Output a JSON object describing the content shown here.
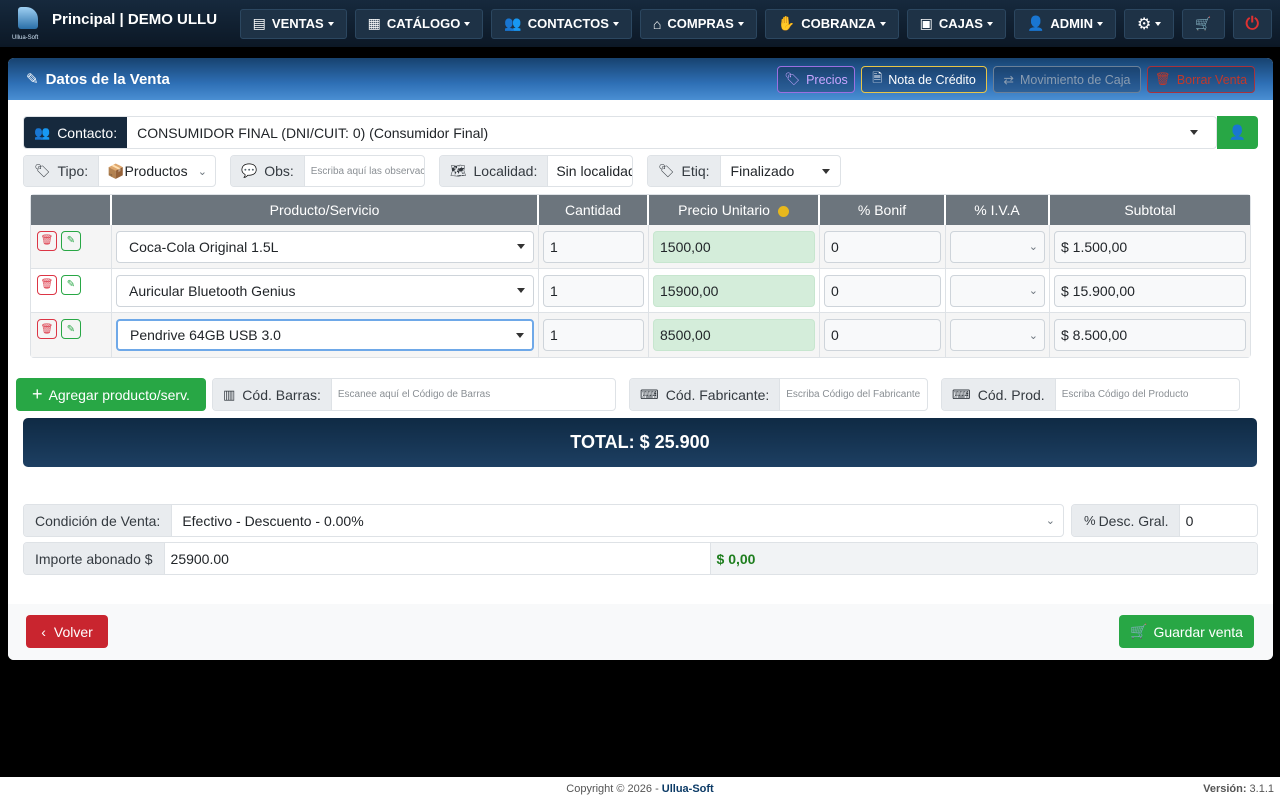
{
  "brand": {
    "title": "Principal | DEMO ULLU",
    "logo_text": "Ullua-Soft"
  },
  "nav": [
    {
      "label": "VENTAS",
      "icon": "cash-register-icon"
    },
    {
      "label": "CATÁLOGO",
      "icon": "boxes-icon"
    },
    {
      "label": "CONTACTOS",
      "icon": "users-icon"
    },
    {
      "label": "COMPRAS",
      "icon": "basket-icon"
    },
    {
      "label": "COBRANZA",
      "icon": "hand-money-icon"
    },
    {
      "label": "CAJAS",
      "icon": "cash-box-icon"
    },
    {
      "label": "ADMIN",
      "icon": "user-gear-icon"
    }
  ],
  "card": {
    "title": "Datos de la Venta",
    "buttons": {
      "precios": "Precios",
      "nota_credito": "Nota de Crédito",
      "movimiento_caja": "Movimiento de Caja",
      "borrar_venta": "Borrar Venta"
    }
  },
  "contacto": {
    "label": "Contacto:",
    "value": "CONSUMIDOR FINAL (DNI/CUIT: 0) (Consumidor Final)"
  },
  "tipo": {
    "label": "Tipo:",
    "value": "📦Productos"
  },
  "obs": {
    "label": "Obs:",
    "placeholder": "Escriba aquí las observaciones"
  },
  "localidad": {
    "label": "Localidad:",
    "value": "Sin localidad"
  },
  "etiq": {
    "label": "Etiq:",
    "value": "Finalizado"
  },
  "table": {
    "headers": [
      "Producto/Servicio",
      "Cantidad",
      "Precio Unitario",
      "% Bonif",
      "% I.V.A",
      "Subtotal"
    ],
    "rows": [
      {
        "producto": "Coca-Cola Original 1.5L",
        "cantidad": "1",
        "precio": "1500,00",
        "bonif": "0",
        "iva": "",
        "subtotal": "$ 1.500,00"
      },
      {
        "producto": "Auricular Bluetooth Genius",
        "cantidad": "1",
        "precio": "15900,00",
        "bonif": "0",
        "iva": "",
        "subtotal": "$ 15.900,00"
      },
      {
        "producto": "Pendrive 64GB USB 3.0",
        "cantidad": "1",
        "precio": "8500,00",
        "bonif": "0",
        "iva": "",
        "subtotal": "$ 8.500,00"
      }
    ]
  },
  "agregar": "Agregar producto/serv.",
  "cod_barras": {
    "label": "Cód. Barras:",
    "placeholder": "Escanee aquí el Código de Barras"
  },
  "cod_fabricante": {
    "label": "Cód. Fabricante:",
    "placeholder": "Escriba Código del Fabricante"
  },
  "cod_prod": {
    "label": "Cód. Prod.",
    "placeholder": "Escriba Código del Producto"
  },
  "total": "TOTAL: $ 25.900",
  "condicion": {
    "label": "Condición de Venta:",
    "value": "Efectivo - Descuento - 0.00%"
  },
  "desc_gral": {
    "label": "Desc. Gral.",
    "value": "0"
  },
  "importe": {
    "label": "Importe abonado $",
    "value": "25900.00",
    "vuelto": "$ 0,00"
  },
  "volver": "Volver",
  "guardar": "Guardar venta",
  "footer": {
    "copyright": "Copyright © 2026 -",
    "brand": "Ullua-Soft",
    "version_label": "Versión:",
    "version": "3.1.1"
  },
  "colors": {
    "navbar": "#16293d",
    "header": "#2e6fb5",
    "success": "#28a745",
    "danger": "#dc3545",
    "total": "#0f2a44",
    "price_bg": "#d4edda"
  }
}
